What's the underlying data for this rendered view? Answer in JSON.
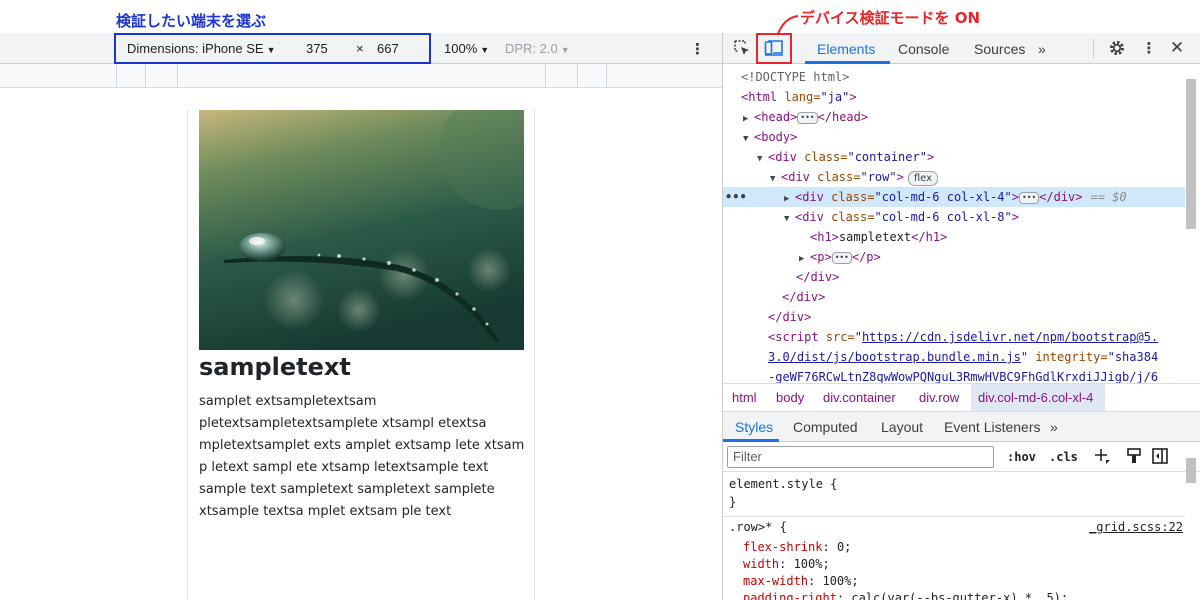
{
  "annotations": {
    "select_device": "検証したい端末を選ぶ",
    "device_mode_on": "デバイス検証モードを ON"
  },
  "device_toolbar": {
    "dimensions_label": "Dimensions: iPhone SE",
    "width": "375",
    "times": "×",
    "height": "667",
    "zoom": "100%",
    "dpr": "DPR: 2.0"
  },
  "page": {
    "heading": "sampletext",
    "paragraph_lines": [
      "samplet extsampletextsam",
      "pletextsampletextsamplete xtsampl etextsa",
      "mpletextsamplet exts amplet extsamp lete xtsam",
      "p letext sampl ete xtsamp letextsample text",
      "sample text sampletext sampletext samplete",
      "xtsample textsa mplet extsam ple text"
    ]
  },
  "devtools": {
    "tabs": [
      "Elements",
      "Console",
      "Sources"
    ],
    "more_tabs": "»",
    "active_tab": "Elements",
    "dom": {
      "doctype": "<!DOCTYPE html>",
      "html_open": "<html",
      "lang_attr": " lang=",
      "lang_val": "\"ja\"",
      "head_open": "<head>",
      "head_close": "</head>",
      "body_open": "<body>",
      "div_open": "<div",
      "class_attr": " class=",
      "container_val": "\"container\"",
      "row_val": "\"row\"",
      "flex_badge": "flex",
      "col4_val": "\"col-md-6 col-xl-4\"",
      "col8_val": "\"col-md-6 col-xl-8\"",
      "h1_line": "sampletext",
      "h1_open": "<h1>",
      "h1_close": "</h1>",
      "p_open": "<p>",
      "p_close": "</p>",
      "div_close": "</div>",
      "gt": ">",
      "eq_marker": "== $0",
      "script_open": "<script",
      "src_attr": " src=",
      "script_url_1": "https://cdn.jsdelivr.net/npm/bootstrap@5.",
      "script_url_2": "3.0/dist/js/bootstrap.bundle.min.js",
      "integrity_attr": " integrity=",
      "integrity_val_1": "\"sha384",
      "integrity_val_2": "-geWF76RCwLtnZ8qwWowPQNguL3RmwHVBC9FhGdlKrxdiJJigb/j/6"
    },
    "breadcrumbs": [
      "html",
      "body",
      "div.container",
      "div.row",
      "div.col-md-6.col-xl-4"
    ],
    "styles_tabs": [
      "Styles",
      "Computed",
      "Layout",
      "Event Listeners"
    ],
    "filter_placeholder": "Filter",
    "hov": ":hov",
    "cls": ".cls",
    "element_style": "element.style {",
    "close_brace": "}",
    "row_selector": ".row>* {",
    "row_source": "_grid.scss:22",
    "declarations": [
      {
        "name": "flex-shrink",
        "value": "0;"
      },
      {
        "name": "width",
        "value": "100%;"
      },
      {
        "name": "max-width",
        "value": "100%;"
      },
      {
        "name": "padding-right",
        "value": "calc(var(--bs-gutter-x) * .5);"
      }
    ]
  },
  "colors": {
    "annotation_blue": "#1a33d6",
    "annotation_red": "#e8262a",
    "accent": "#1a73e8"
  }
}
